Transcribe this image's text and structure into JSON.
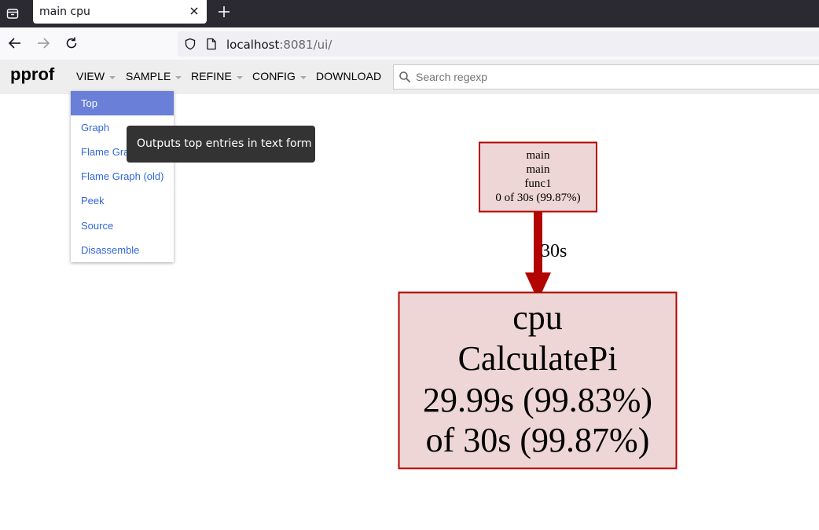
{
  "browser": {
    "tab_title": "main cpu",
    "url_host": "localhost",
    "url_rest": ":8081/ui/"
  },
  "header": {
    "logo": "pprof",
    "menus": [
      "VIEW",
      "SAMPLE",
      "REFINE",
      "CONFIG",
      "DOWNLOAD"
    ],
    "search_placeholder": "Search regexp"
  },
  "view_menu": {
    "items": [
      "Top",
      "Graph",
      "Flame Graph",
      "Flame Graph (old)",
      "Peek",
      "Source",
      "Disassemble"
    ],
    "selected": "Top",
    "tooltip": "Outputs top entries in text form"
  },
  "graph": {
    "node1": {
      "lines": [
        "main",
        "main",
        "func1",
        "0 of 30s (99.87%)"
      ]
    },
    "edge": {
      "label": "30s"
    },
    "node2": {
      "lines": [
        "cpu",
        "CalculatePi",
        "29.99s (99.83%)",
        "of 30s (99.87%)"
      ]
    },
    "colors": {
      "node_fill": "#edd6d5",
      "node_stroke": "#b20400",
      "edge": "#b20400"
    }
  }
}
